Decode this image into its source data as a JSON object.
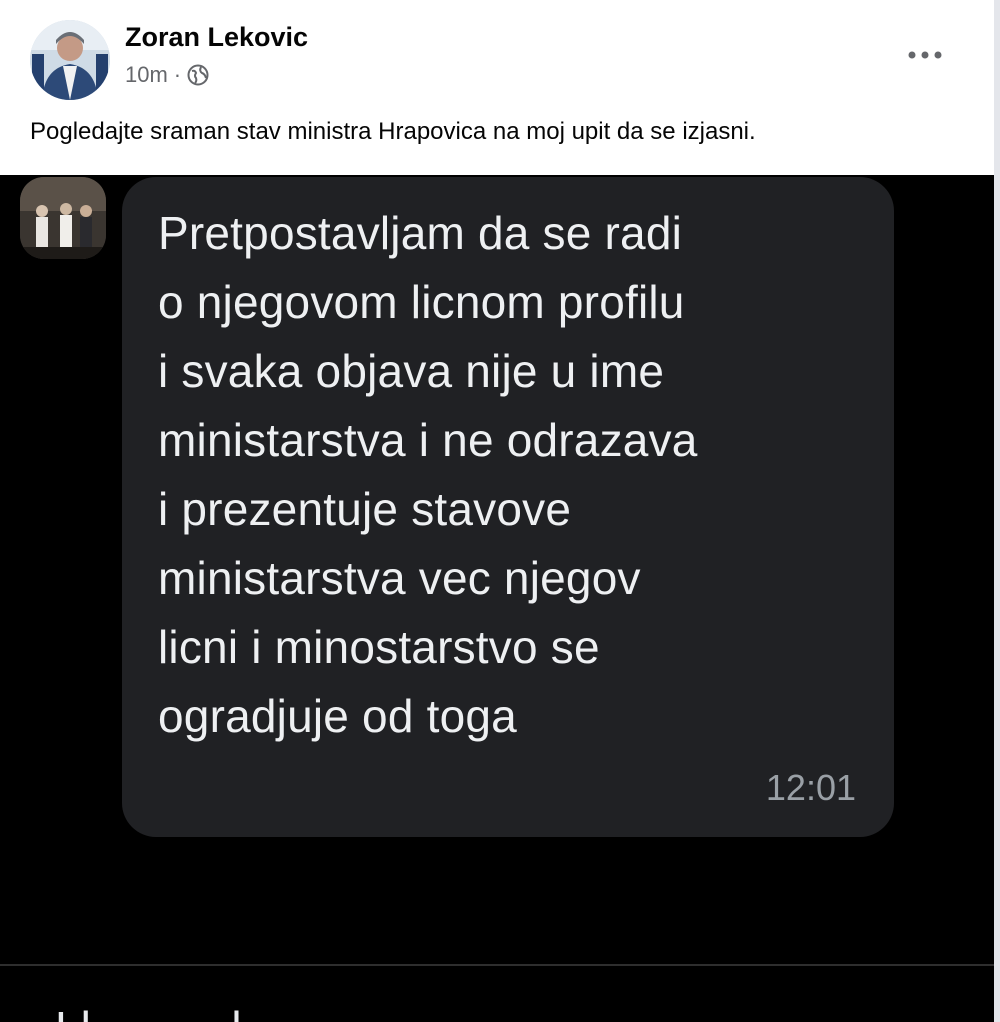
{
  "post": {
    "author": "Zoran Lekovic",
    "time": "10m",
    "separator": "·",
    "visibility_icon": "globe-icon",
    "more_icon": "more-options-icon",
    "text": "Pogledajte sraman stav ministra Hrapovica na moj upit da se izjasni."
  },
  "screenshot": {
    "message": "Pretpostavljam da se radi\no njegovom licnom profilu\ni svaka objava nije u ime\nministarstva i ne odrazava\ni prezentuje stavove\nministarstva vec njegov\nlicni i minostarstvo se\nogradjuje od toga",
    "message_time": "12:01",
    "cut_off_text": "Ll... ... ...l"
  },
  "colors": {
    "bubble": "#202124",
    "screenshot_bg": "#000000",
    "meta_text": "#65676b"
  }
}
